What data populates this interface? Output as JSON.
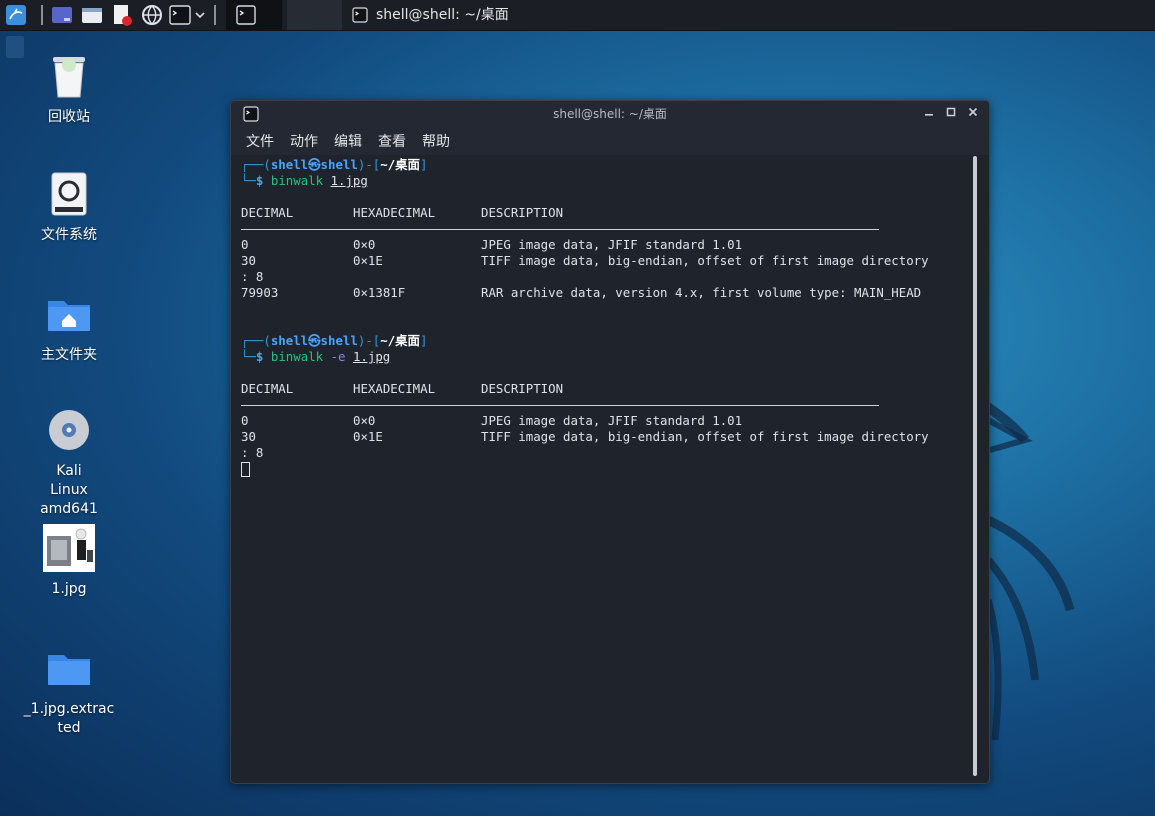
{
  "taskbar": {
    "window_title": "shell@shell: ~/桌面"
  },
  "desktop": {
    "icons": [
      {
        "label": "回收站",
        "icon": "trash-icon"
      },
      {
        "label": "文件系统",
        "icon": "drive-icon"
      },
      {
        "label": "主文件夹",
        "icon": "home-folder-icon"
      },
      {
        "label": "Kali Linux amd641",
        "icon": "disc-icon"
      },
      {
        "label": "1.jpg",
        "icon": "image-thumbnail"
      },
      {
        "label": "_1.jpg.extracted",
        "icon": "folder-icon"
      }
    ]
  },
  "terminal": {
    "title": "shell@shell: ~/桌面",
    "menu": [
      "文件",
      "动作",
      "编辑",
      "查看",
      "帮助"
    ],
    "prompt": {
      "user": "shell",
      "host": "shell",
      "path": "~/桌面"
    },
    "cmd1": {
      "bin": "binwalk",
      "flag": "",
      "arg": "1.jpg"
    },
    "cmd2": {
      "bin": "binwalk",
      "flag": "-e",
      "arg": "1.jpg"
    },
    "headers": {
      "dec": "DECIMAL",
      "hex": "HEXADECIMAL",
      "desc": "DESCRIPTION"
    },
    "out1": [
      {
        "dec": "0",
        "hex": "0×0",
        "desc": "JPEG image data, JFIF standard 1.01"
      },
      {
        "dec": "30",
        "hex": "0×1E",
        "desc": "TIFF image data, big-endian, offset of first image directory"
      },
      {
        "dec": ": 8",
        "hex": "",
        "desc": ""
      },
      {
        "dec": "79903",
        "hex": "0×1381F",
        "desc": "RAR archive data, version 4.x, first volume type: MAIN_HEAD"
      }
    ],
    "out2": [
      {
        "dec": "0",
        "hex": "0×0",
        "desc": "JPEG image data, JFIF standard 1.01"
      },
      {
        "dec": "30",
        "hex": "0×1E",
        "desc": "TIFF image data, big-endian, offset of first image directory"
      },
      {
        "dec": ": 8",
        "hex": "",
        "desc": ""
      }
    ]
  }
}
